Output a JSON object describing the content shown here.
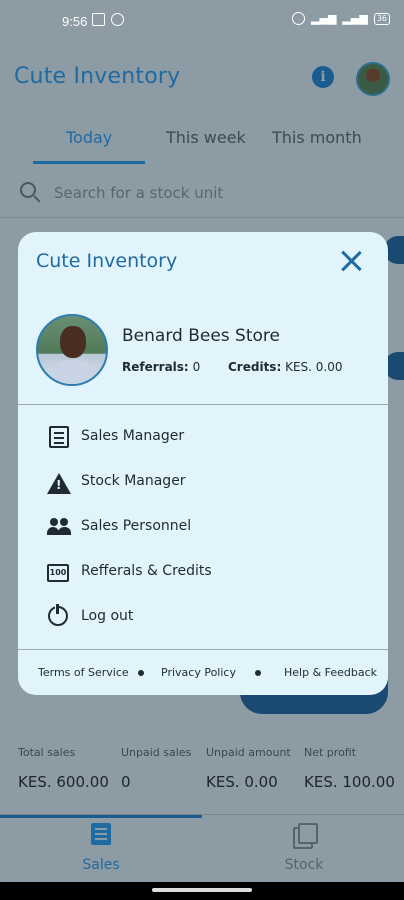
{
  "status_bar": {
    "time": "9:56",
    "battery": "36"
  },
  "app": {
    "title": "Cute Inventory"
  },
  "tabs": [
    {
      "label": "Today",
      "active": true
    },
    {
      "label": "This week",
      "active": false
    },
    {
      "label": "This month",
      "active": false
    }
  ],
  "search": {
    "placeholder": "Search for a stock unit"
  },
  "summary": [
    {
      "label": "Total sales",
      "value": "KES. 600.00"
    },
    {
      "label": "Unpaid sales",
      "value": "0"
    },
    {
      "label": "Unpaid amount",
      "value": "KES. 0.00"
    },
    {
      "label": "Net profit",
      "value": "KES. 100.00"
    }
  ],
  "bottom_nav": [
    {
      "label": "Sales",
      "icon": "list-icon",
      "active": true
    },
    {
      "label": "Stock",
      "icon": "stack-icon",
      "active": false
    }
  ],
  "dialog": {
    "title": "Cute Inventory",
    "store_name": "Benard Bees Store",
    "referrals_label": "Referrals:",
    "referrals_value": "0",
    "credits_label": "Credits:",
    "credits_value": "KES. 0.00",
    "menu": [
      {
        "label": "Sales Manager",
        "icon": "list-icon"
      },
      {
        "label": "Stock Manager",
        "icon": "warning-icon"
      },
      {
        "label": "Sales Personnel",
        "icon": "people-icon"
      },
      {
        "label": "Refferals & Credits",
        "icon": "badge-100-icon"
      },
      {
        "label": "Log out",
        "icon": "power-icon"
      }
    ],
    "badge_text": "100",
    "footer": {
      "terms": "Terms of Service",
      "privacy": "Privacy Policy",
      "help": "Help & Feedback"
    }
  },
  "colors": {
    "accent": "#1f6aa0",
    "dialog_bg": "#e2f4fb",
    "scrim": "#8d9ba5"
  }
}
